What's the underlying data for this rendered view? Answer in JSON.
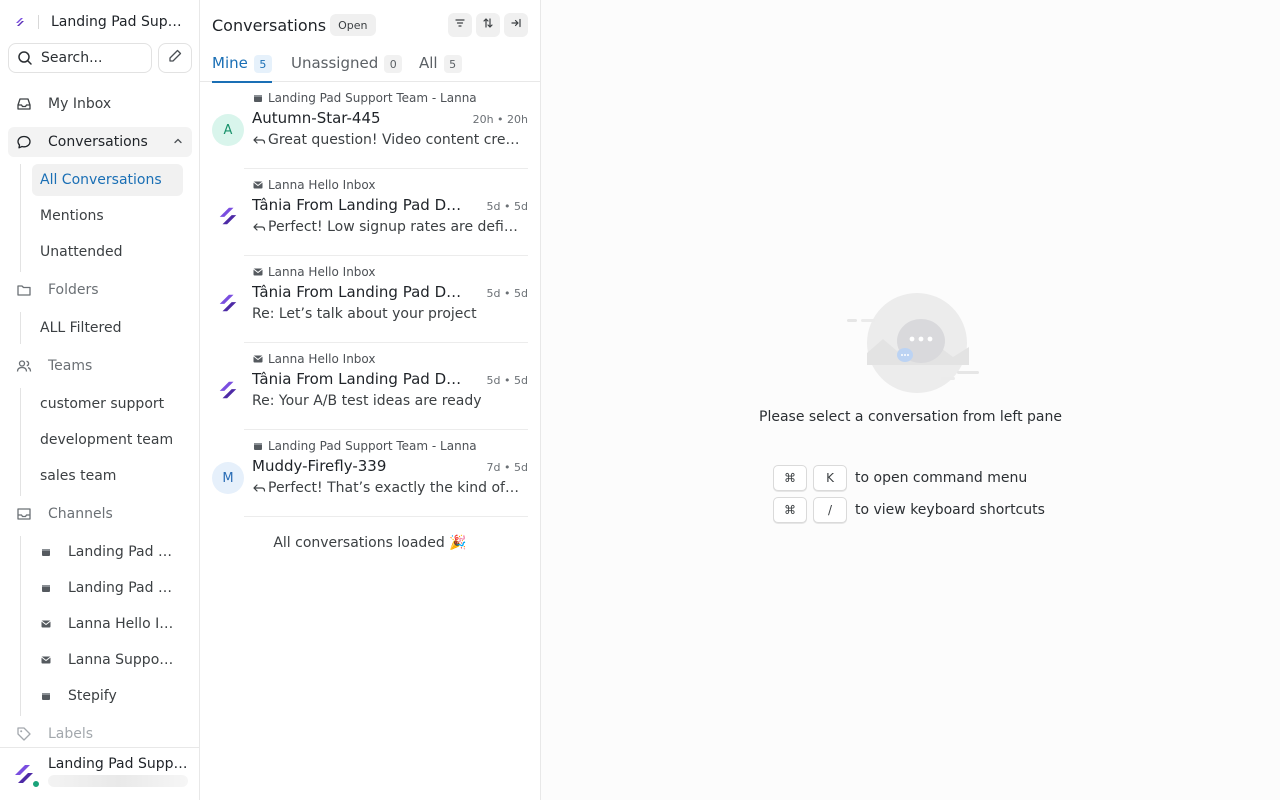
{
  "brand": {
    "name": "Landing Pad Support"
  },
  "search": {
    "label": "Search..."
  },
  "nav": {
    "my_inbox": "My Inbox",
    "conversations": "Conversations",
    "conversation_items": [
      "All Conversations",
      "Mentions",
      "Unattended"
    ],
    "folders": "Folders",
    "folder_items": [
      "ALL Filtered"
    ],
    "teams": "Teams",
    "team_items": [
      "customer support",
      "development team",
      "sales team"
    ],
    "channels": "Channels",
    "channel_items": [
      "Landing Pad Support",
      "Landing Pad Support",
      "Lanna Hello Inbox",
      "Lanna Support Inbox",
      "Stepify"
    ],
    "labels": "Labels"
  },
  "account": {
    "name": "Landing Pad Support"
  },
  "list": {
    "title": "Conversations",
    "status": "Open",
    "tabs": [
      {
        "label": "Mine",
        "count": "5"
      },
      {
        "label": "Unassigned",
        "count": "0"
      },
      {
        "label": "All",
        "count": "5"
      }
    ],
    "conversations": [
      {
        "inbox": "Landing Pad Support Team - Lanna",
        "name": "Autumn-Star-445",
        "time": "20h • 20h",
        "message": "Great question! Video content creation is a",
        "avatar": "A",
        "replied": true
      },
      {
        "inbox": "Lanna Hello Inbox",
        "name": "Tânia From Landing Pad Digital",
        "time": "5d • 5d",
        "message": "Perfect! Low signup rates are definitely",
        "avatar": "",
        "replied": true
      },
      {
        "inbox": "Lanna Hello Inbox",
        "name": "Tânia From Landing Pad Digital",
        "time": "5d • 5d",
        "message": "Re: Let’s talk about your project",
        "avatar": "",
        "replied": false
      },
      {
        "inbox": "Lanna Hello Inbox",
        "name": "Tânia From Landing Pad Digital",
        "time": "5d • 5d",
        "message": "Re: Your A/B test ideas are ready",
        "avatar": "",
        "replied": false
      },
      {
        "inbox": "Landing Pad Support Team - Lanna",
        "name": "Muddy-Firefly-339",
        "time": "7d • 5d",
        "message": "Perfect! That’s exactly the kind of feedback",
        "avatar": "M",
        "replied": true
      }
    ],
    "footer": "All conversations loaded 🎉"
  },
  "pane": {
    "empty_message": "Please select a conversation from left pane",
    "shortcuts": [
      {
        "key1": "⌘",
        "key2": "K",
        "label": "to open command menu"
      },
      {
        "key1": "⌘",
        "key2": "/",
        "label": "to view keyboard shortcuts"
      }
    ]
  },
  "colors": {
    "accent": "#1a6fb5",
    "brand_purple": "#6b3fd4",
    "online": "#1aa37a"
  }
}
